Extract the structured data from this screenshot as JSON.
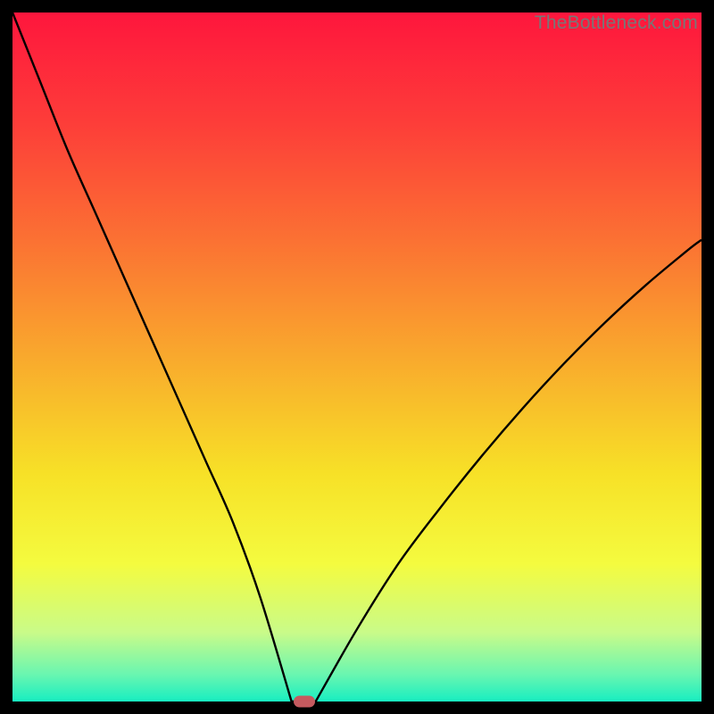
{
  "watermark": "TheBottleneck.com",
  "colors": {
    "gradient_stops": [
      {
        "offset": 0.0,
        "color": "#fe163d"
      },
      {
        "offset": 0.16,
        "color": "#fd3d39"
      },
      {
        "offset": 0.33,
        "color": "#fb7133"
      },
      {
        "offset": 0.5,
        "color": "#f9a92d"
      },
      {
        "offset": 0.67,
        "color": "#f7e127"
      },
      {
        "offset": 0.8,
        "color": "#f4fb3f"
      },
      {
        "offset": 0.9,
        "color": "#c9fb89"
      },
      {
        "offset": 0.96,
        "color": "#6bf6b0"
      },
      {
        "offset": 1.0,
        "color": "#17eec1"
      }
    ],
    "curve": "#000000",
    "marker": "#c55a5f",
    "frame_bg": "#000000"
  },
  "chart_data": {
    "type": "line",
    "title": "",
    "xlabel": "",
    "ylabel": "",
    "xlim": [
      0,
      100
    ],
    "ylim": [
      0,
      100
    ],
    "flat_region_x": [
      40.5,
      44
    ],
    "flat_value": 0,
    "marker": {
      "x": 42.3,
      "y": 0
    },
    "series": [
      {
        "name": "bottleneck-curve",
        "x": [
          0,
          4,
          8,
          12,
          16,
          20,
          24,
          28,
          32,
          36,
          40.5,
          44,
          50,
          56,
          62,
          68,
          74,
          80,
          86,
          92,
          98,
          100
        ],
        "values": [
          100,
          90,
          80,
          71,
          62,
          53,
          44,
          35,
          26,
          15,
          0,
          0,
          10.5,
          20,
          28,
          35.5,
          42.5,
          49,
          55,
          60.5,
          65.5,
          67
        ]
      }
    ]
  }
}
